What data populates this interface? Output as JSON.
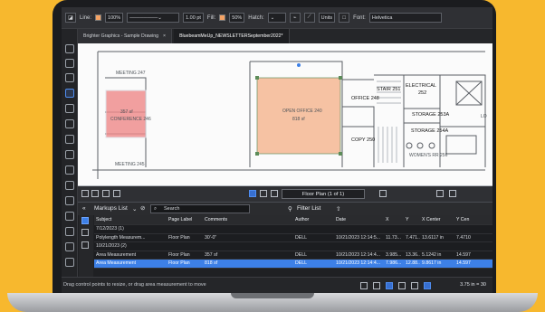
{
  "toolbar": {
    "line_label": "Line:",
    "percent_a": "100%",
    "thickness": "1.00 pt",
    "fill_label": "Fill:",
    "percent_b": "50%",
    "hatch_label": "Hatch:",
    "units_label": "Units",
    "font_label": "Font:",
    "font_value": "Helvetica"
  },
  "tabs": [
    {
      "label": "Brighter Graphics - Sample Drawing"
    },
    {
      "label": "BluebeamMeUp_NEWSLETTERSeptember2022*"
    }
  ],
  "canvas": {
    "meeting_top": "MEETING 247",
    "conference_line1": "357 sf",
    "conference_line2": "CONFERENCE 246",
    "open_office_line1": "OPEN OFFICE 240",
    "open_office_line2": "818 sf",
    "meeting_bottom": "MEETING 245",
    "office": "OFFICE 248",
    "copy": "COPY 250",
    "stair": "STAIR 251",
    "electrical": "ELECTRICAL",
    "electrical_no": "252",
    "storage_a": "STORAGE 253A",
    "storage_b": "STORAGE 254A",
    "womens": "WOMEN'S RR 256",
    "side_label": "LO"
  },
  "pager": {
    "page_label": "Floor Plan (1 of 1)"
  },
  "markups": {
    "title": "Markups List",
    "search_placeholder": "Search",
    "filter_label": "Filter List",
    "headers": [
      "Subject",
      "Page Label",
      "Comments",
      "Author",
      "Date",
      "X",
      "Y",
      "X Center",
      "Y Cen"
    ],
    "rows": [
      {
        "subject": "7/12/2023 (1)",
        "page": "",
        "comment": "",
        "author": "",
        "date": "",
        "x": "",
        "y": "",
        "xc": "",
        "yc": ""
      },
      {
        "subject": "Polylength Measurem...",
        "page": "Floor Plan",
        "comment": "30'-0\"",
        "author": "DELL",
        "date": "10/21/2023 12:14:5...",
        "x": "11.73...",
        "y": "7.471...",
        "xc": "13.6117 in",
        "yc": "7.4710"
      },
      {
        "subject": "10/21/2023 (2)",
        "page": "",
        "comment": "",
        "author": "",
        "date": "",
        "x": "",
        "y": "",
        "xc": "",
        "yc": ""
      },
      {
        "subject": "Area Measurement",
        "page": "Floor Plan",
        "comment": "357 sf",
        "author": "DELL",
        "date": "10/21/2023 12:14:4...",
        "x": "3.985...",
        "y": "13.36...",
        "xc": "5.1242 in",
        "yc": "14.597"
      },
      {
        "subject": "Area Measurement",
        "page": "Floor Plan",
        "comment": "818 sf",
        "author": "DELL",
        "date": "10/21/2023 12:14:4...",
        "x": "7.986...",
        "y": "12.88...",
        "xc": "9.8617 in",
        "yc": "14.597"
      }
    ]
  },
  "status": {
    "text": "Drag control points to resize, or drag area measurement to move",
    "scale": "3.75 in = 30"
  },
  "colors": {
    "accent": "#3d80e7",
    "peach": "#f6a364",
    "pink": "#ef8b8b",
    "background": "#f7b82e"
  }
}
